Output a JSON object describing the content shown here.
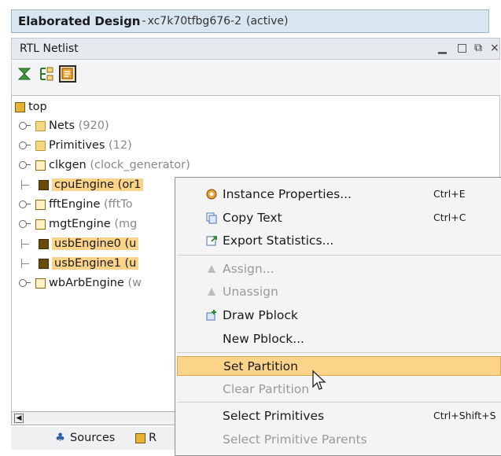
{
  "title": {
    "main": "Elaborated Design",
    "sep": " - ",
    "part": "xc7k70tfbg676-2",
    "state": "(active)"
  },
  "panel": {
    "title": "RTL Netlist",
    "controls": {
      "minimize": "▁",
      "maximize": "□",
      "restore": "⧉",
      "close": "×"
    }
  },
  "tree": {
    "root": "top",
    "items": [
      {
        "name": "Nets",
        "detail": "(920)"
      },
      {
        "name": "Primitives",
        "detail": "(12)"
      },
      {
        "name": "clkgen",
        "detail": "(clock_generator)"
      },
      {
        "name": "cpuEngine (or1",
        "detail": ""
      },
      {
        "name": "fftEngine",
        "detail": "(fftTo"
      },
      {
        "name": "mgtEngine",
        "detail": "(mg"
      },
      {
        "name": "usbEngine0 (u",
        "detail": ""
      },
      {
        "name": "usbEngine1 (u",
        "detail": ""
      },
      {
        "name": "wbArbEngine",
        "detail": "(w"
      }
    ]
  },
  "tabs": {
    "sources": "Sources",
    "second": "R"
  },
  "menu": {
    "instance_properties": {
      "label": "Instance Properties...",
      "shortcut": "Ctrl+E"
    },
    "copy_text": {
      "label": "Copy Text",
      "shortcut": "Ctrl+C"
    },
    "export_statistics": {
      "label": "Export Statistics..."
    },
    "assign": {
      "label": "Assign..."
    },
    "unassign": {
      "label": "Unassign"
    },
    "draw_pblock": {
      "label": "Draw Pblock"
    },
    "new_pblock": {
      "label": "New Pblock..."
    },
    "set_partition": {
      "label": "Set Partition"
    },
    "clear_partition": {
      "label": "Clear Partition"
    },
    "select_primitives": {
      "label": "Select Primitives",
      "shortcut": "Ctrl+Shift+S"
    },
    "select_primitive_parents": {
      "label": "Select Primitive Parents"
    }
  },
  "colors": {
    "highlight": "#fbd48a",
    "title_bg": "#d8e6f2",
    "disabled": "#9a9a9a"
  }
}
